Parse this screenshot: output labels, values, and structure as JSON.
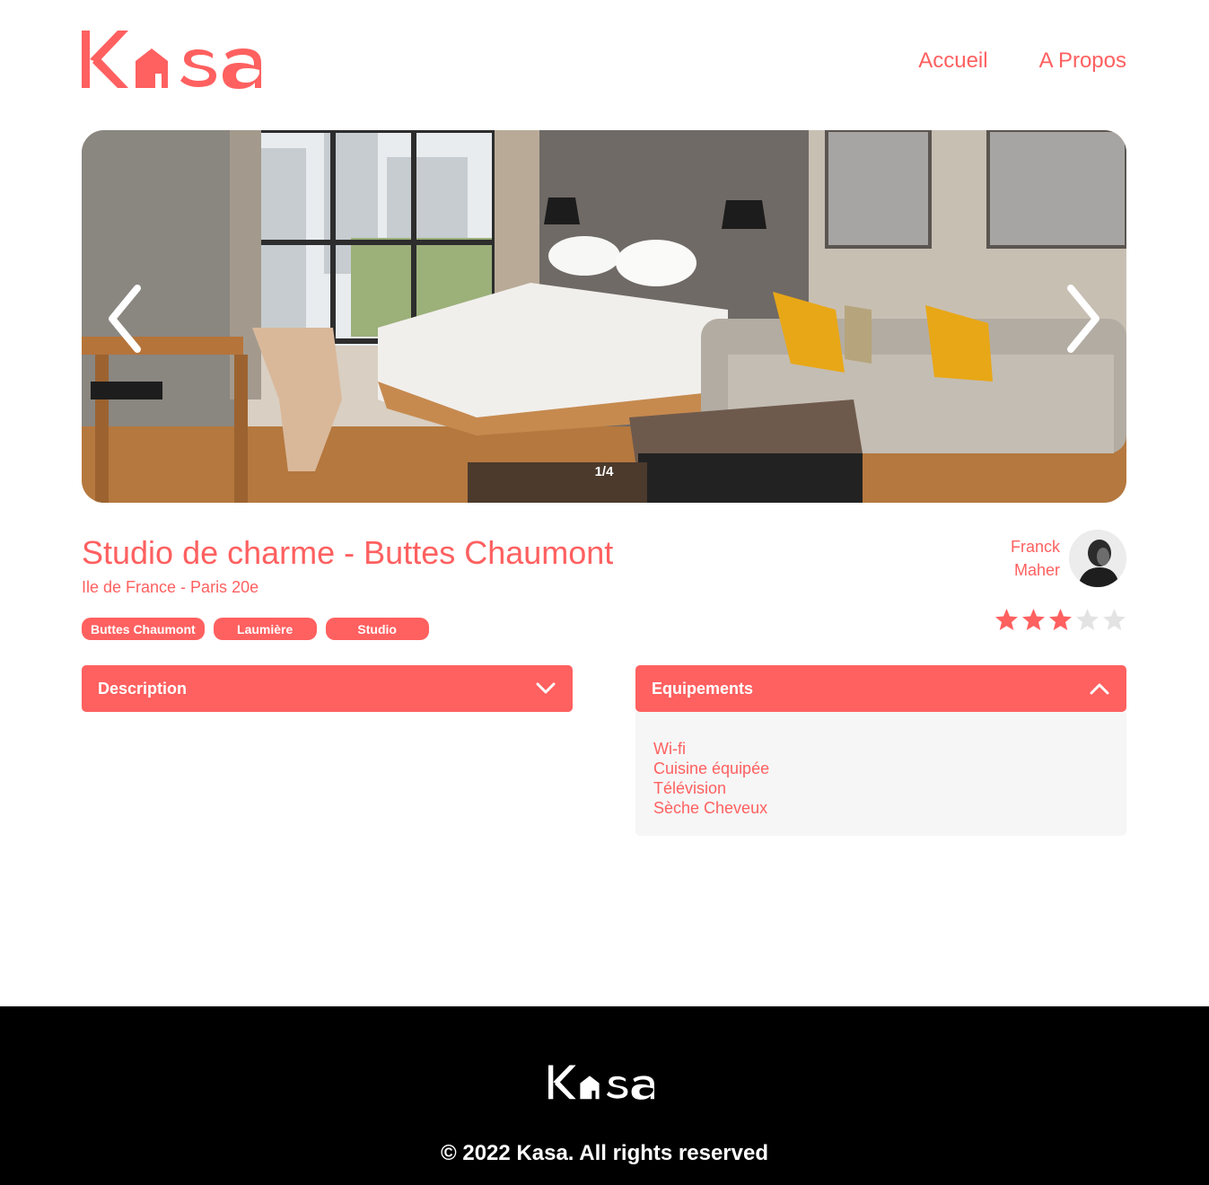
{
  "header": {
    "logo_text": "Kasa",
    "nav": [
      {
        "label": "Accueil"
      },
      {
        "label": "A Propos"
      }
    ]
  },
  "carousel": {
    "counter": "1/4",
    "current": 1,
    "total": 4
  },
  "listing": {
    "title": "Studio de charme - Buttes Chaumont",
    "location": "Ile de France - Paris 20e",
    "tags": [
      "Buttes Chaumont",
      "Laumière",
      "Studio"
    ],
    "host": {
      "first_name": "Franck",
      "last_name": "Maher"
    },
    "rating": 3,
    "rating_max": 5
  },
  "collapses": {
    "description": {
      "title": "Description",
      "expanded": false
    },
    "equipements": {
      "title": "Equipements",
      "expanded": true,
      "items": [
        "Wi-fi",
        "Cuisine équipée",
        "Télévision",
        "Sèche Cheveux"
      ]
    }
  },
  "footer": {
    "logo_text": "Kasa",
    "copyright": "© 2022 Kasa. All rights reserved"
  },
  "colors": {
    "accent": "#FF6060",
    "panel": "#F6F6F6",
    "footer": "#000000",
    "star_off": "#E3E3E3"
  }
}
